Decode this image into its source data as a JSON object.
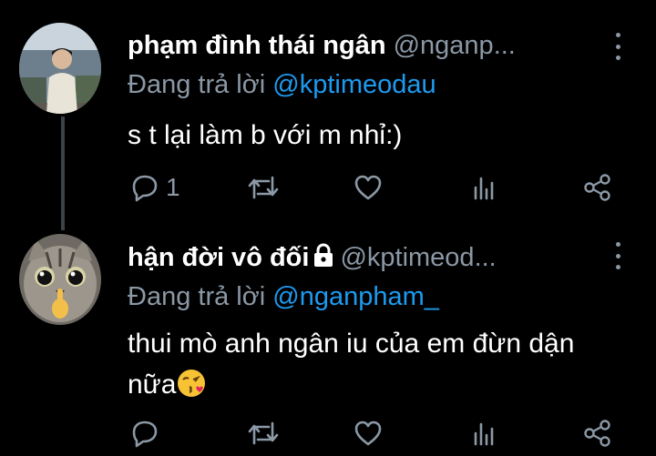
{
  "tweets": [
    {
      "display_name": "phạm đình thái ngân",
      "handle": "@nganp...",
      "replying_prefix": "Đang trả lời",
      "replying_to": "@kptimeodau",
      "text": "s t lại làm b với m nhỉ:)",
      "reply_count": "1",
      "locked": false
    },
    {
      "display_name": "hận đời vô đối",
      "handle": "@kptimeod...",
      "replying_prefix": "Đang trả lời",
      "replying_to": "@nganpham_",
      "text": "thui mò anh ngân iu của em đừn dận nữa",
      "reply_count": "",
      "locked": true
    }
  ],
  "icons": {
    "reply": "reply-icon",
    "retweet": "retweet-icon",
    "like": "heart-icon",
    "views": "bar-chart-icon",
    "share": "share-icon",
    "more": "more-vertical-icon",
    "lock": "lock-icon",
    "emoji": "kissing-face-emoji"
  },
  "colors": {
    "background": "#000000",
    "text": "#ffffff",
    "secondary": "#8b98a5",
    "mention": "#1d9bf0",
    "thread_line": "#3d4247"
  }
}
